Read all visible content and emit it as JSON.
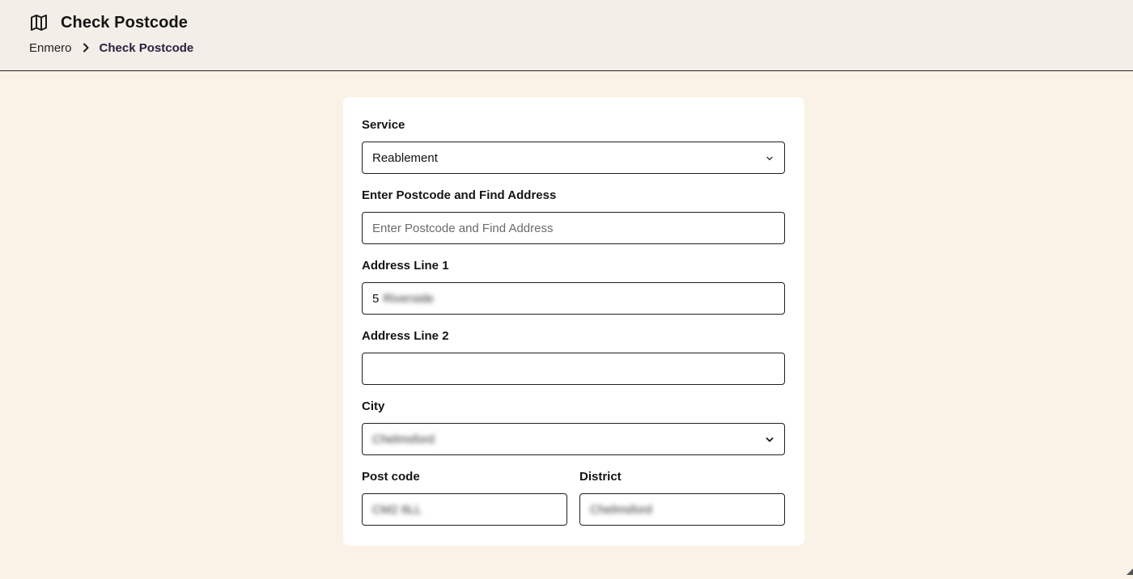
{
  "header": {
    "title": "Check Postcode",
    "icon": "map-icon"
  },
  "breadcrumb": {
    "root": "Enmero",
    "separator_icon": "chevron-right-icon",
    "current": "Check Postcode"
  },
  "form": {
    "service": {
      "label": "Service",
      "value": "Reablement"
    },
    "postcode_search": {
      "label": "Enter Postcode and Find Address",
      "placeholder": "Enter Postcode and Find Address",
      "value": ""
    },
    "address_line_1": {
      "label": "Address Line 1",
      "value_number": "5",
      "value_redacted": "Riverside"
    },
    "address_line_2": {
      "label": "Address Line 2",
      "value": ""
    },
    "city": {
      "label": "City",
      "value": "Chelmsford"
    },
    "post_code": {
      "label": "Post code",
      "value": "CM2 6LL"
    },
    "district": {
      "label": "District",
      "value": "Chelmsford"
    }
  },
  "colors": {
    "header_bg": "#f3efe8",
    "page_bg": "#faf1e7",
    "border": "#1f1f1f",
    "breadcrumb_current": "#2a2140"
  }
}
